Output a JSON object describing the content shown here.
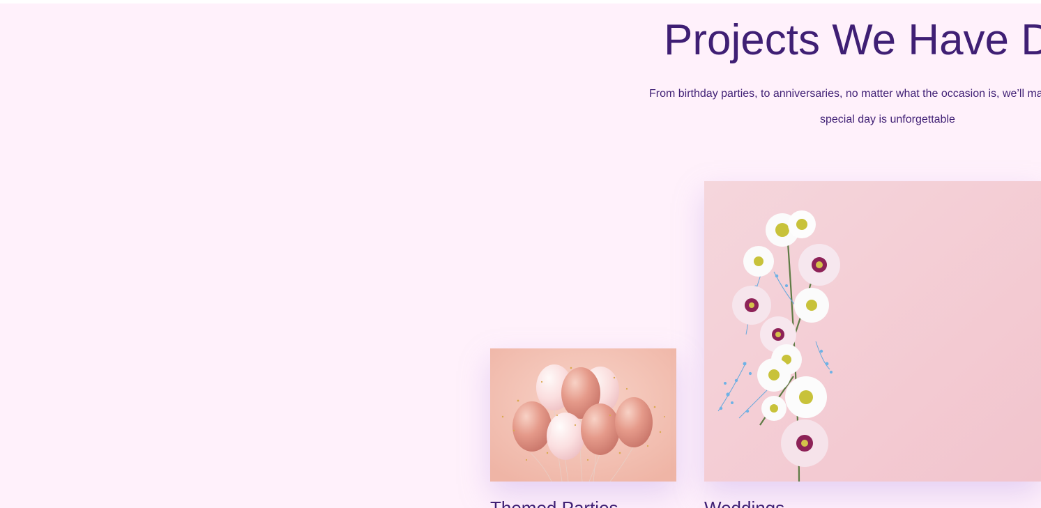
{
  "section": {
    "title": "Projects We Have D",
    "subtitle_line1": "From birthday parties, to anniversaries, no matter what the occasion is, we’ll ma",
    "subtitle_line2": "special day is unforgettable"
  },
  "projects": [
    {
      "label": "Themed Parties",
      "image": "balloons-image"
    },
    {
      "label": "Weddings",
      "image": "flowers-image"
    }
  ],
  "colors": {
    "background": "#fff1fb",
    "heading": "#3f1f74",
    "balloon_card": "#f4c6bc",
    "flower_card": "#f6cdd5"
  }
}
